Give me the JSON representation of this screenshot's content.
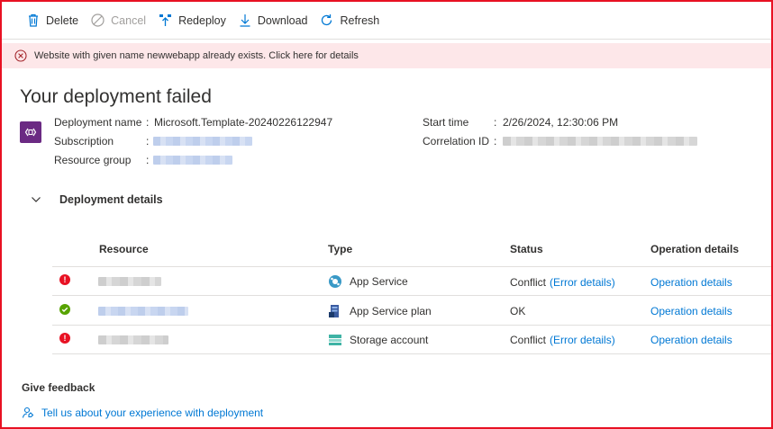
{
  "toolbar": {
    "delete_label": "Delete",
    "cancel_label": "Cancel",
    "redeploy_label": "Redeploy",
    "download_label": "Download",
    "refresh_label": "Refresh"
  },
  "banner": {
    "message": "Website with given name newwebapp already exists. Click here for details"
  },
  "page": {
    "title": "Your deployment failed"
  },
  "deployment": {
    "name_label": "Deployment name",
    "name_value": "Microsoft.Template-20240226122947",
    "subscription_label": "Subscription",
    "resource_group_label": "Resource group",
    "start_time_label": "Start time",
    "start_time_value": "2/26/2024, 12:30:06 PM",
    "correlation_label": "Correlation ID",
    "separator": ":"
  },
  "details": {
    "section_title": "Deployment details",
    "columns": {
      "resource": "Resource",
      "type": "Type",
      "status": "Status",
      "operation": "Operation details"
    },
    "rows": [
      {
        "status_kind": "error",
        "type": "App Service",
        "type_icon": "app-service-icon",
        "status": "Conflict",
        "status_link": "(Error details)",
        "operation": "Operation details"
      },
      {
        "status_kind": "success",
        "type": "App Service plan",
        "type_icon": "app-service-plan-icon",
        "status": "OK",
        "status_link": "",
        "operation": "Operation details"
      },
      {
        "status_kind": "error",
        "type": "Storage account",
        "type_icon": "storage-account-icon",
        "status": "Conflict",
        "status_link": "(Error details)",
        "operation": "Operation details"
      }
    ]
  },
  "feedback": {
    "title": "Give feedback",
    "link": "Tell us about your experience with deployment"
  },
  "colors": {
    "accent": "#0078d4",
    "error": "#e81123",
    "success": "#57a300",
    "banner_bg": "#fde7e9",
    "deployment_tile": "#6b2a83"
  }
}
